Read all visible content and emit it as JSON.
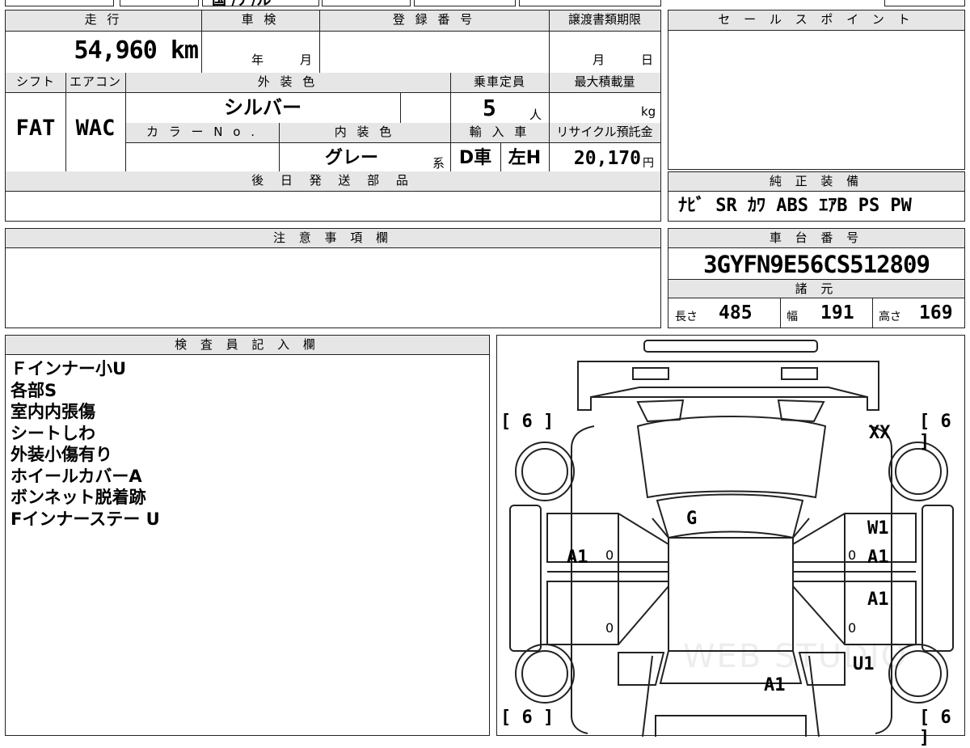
{
  "top_strip": {
    "partial_text": "国 /ア/ル"
  },
  "mileage": {
    "label": "走 行",
    "value": "54,960 km"
  },
  "shaken": {
    "label": "車 検",
    "year_unit": "年",
    "month_unit": "月"
  },
  "registration": {
    "label": "登 録 番 号"
  },
  "transfer_deadline": {
    "label": "譲渡書類期限",
    "month_unit": "月",
    "day_unit": "日"
  },
  "shift": {
    "label": "シフト",
    "value": "FAT"
  },
  "aircon": {
    "label": "エアコン",
    "value": "WAC"
  },
  "exterior_color": {
    "label": "外 装 色",
    "value": "シルバー"
  },
  "capacity": {
    "label": "乗車定員",
    "value": "5",
    "unit": "人"
  },
  "max_load": {
    "label": "最大積載量",
    "unit": "kg"
  },
  "color_no": {
    "label": "カ ラ ー N o ."
  },
  "interior_color": {
    "label": "内 装 色",
    "value": "グレー",
    "suffix": "系"
  },
  "import": {
    "label": "輸 入 車",
    "value1": "D車",
    "value2": "左H"
  },
  "recycle": {
    "label": "リサイクル預託金",
    "value": "20,170",
    "unit": "円"
  },
  "later_parts": {
    "label": "後 日 発 送 部 品"
  },
  "sales_point": {
    "label": "セ ー ル ス ポ イ ン ト"
  },
  "equipment": {
    "label": "純 正 装 備",
    "value": "ﾅﾋﾞ SR ｶﾜ ABS ｴｱB PS PW"
  },
  "notes": {
    "label": "注 意 事 項 欄"
  },
  "chassis": {
    "label": "車 台 番 号",
    "value": "3GYFN9E56CS512809"
  },
  "specs": {
    "label": "諸 元",
    "length_label": "長さ",
    "length": "485",
    "width_label": "幅",
    "width": "191",
    "height_label": "高さ",
    "height": "169"
  },
  "inspector": {
    "label": "検 査 員 記 入 欄",
    "lines": [
      "Ｆインナー小U",
      "各部S",
      "室内内張傷",
      "シートしわ",
      "外装小傷有り",
      "ホイールカバーA",
      "ボンネット脱着跡",
      "Fインナーステー U"
    ]
  },
  "diagram": {
    "tire_fl": "6",
    "tire_fr": "6",
    "tire_rl": "6",
    "tire_rr": "6",
    "marks": {
      "roof_rear": "XX",
      "hood": "G",
      "front_left_fender": "A1",
      "door_right_front_w": "W1",
      "door_right_front": "A1",
      "door_right_rear": "A1",
      "right_rear_quarter": "U1",
      "rear_bottom": "A1",
      "zero_1": "0",
      "zero_2": "0",
      "zero_3": "0",
      "zero_4": "0"
    },
    "watermark": "WEB STUDIO"
  }
}
